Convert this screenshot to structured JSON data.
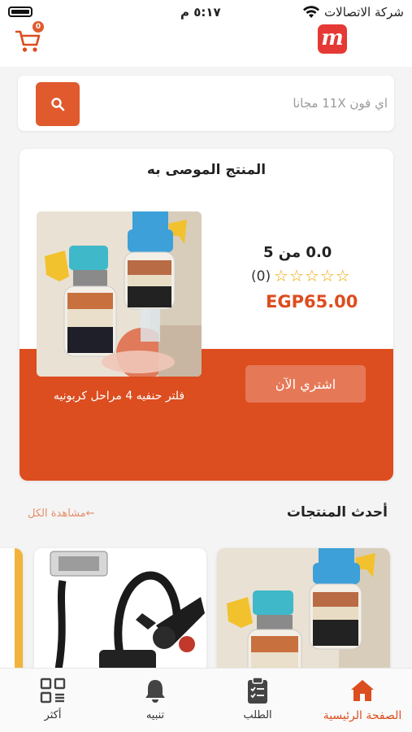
{
  "status_bar": {
    "time": "٥:١٧ م",
    "carrier": "شركة الاتصالات"
  },
  "header": {
    "logo_text": "m",
    "cart_count": "0"
  },
  "search": {
    "placeholder": "اي فون 11X مجانا"
  },
  "recommended": {
    "title": "المنتج الموصى به",
    "rating_text": "0.0 من 5",
    "stars": 0,
    "stars_max": 5,
    "review_count": "(0)",
    "price": "EGP65.00",
    "buy_label": "اشتري الآن",
    "product_name": "فلتر حنفيه 4 مراحل كربونيه"
  },
  "latest": {
    "title": "أحدث المنتجات",
    "view_all": "مشاهدة الكل"
  },
  "bottom_nav": {
    "items": [
      {
        "label": "الصفحة الرئيسية",
        "icon": "home-icon",
        "active": true
      },
      {
        "label": "الطلب",
        "icon": "clipboard-icon",
        "active": false
      },
      {
        "label": "تنبيه",
        "icon": "bell-icon",
        "active": false
      },
      {
        "label": "أكثر",
        "icon": "grid-icon",
        "active": false
      }
    ]
  },
  "colors": {
    "accent": "#dc4d1f",
    "star": "#f0a500",
    "background": "#f4f4f4"
  }
}
